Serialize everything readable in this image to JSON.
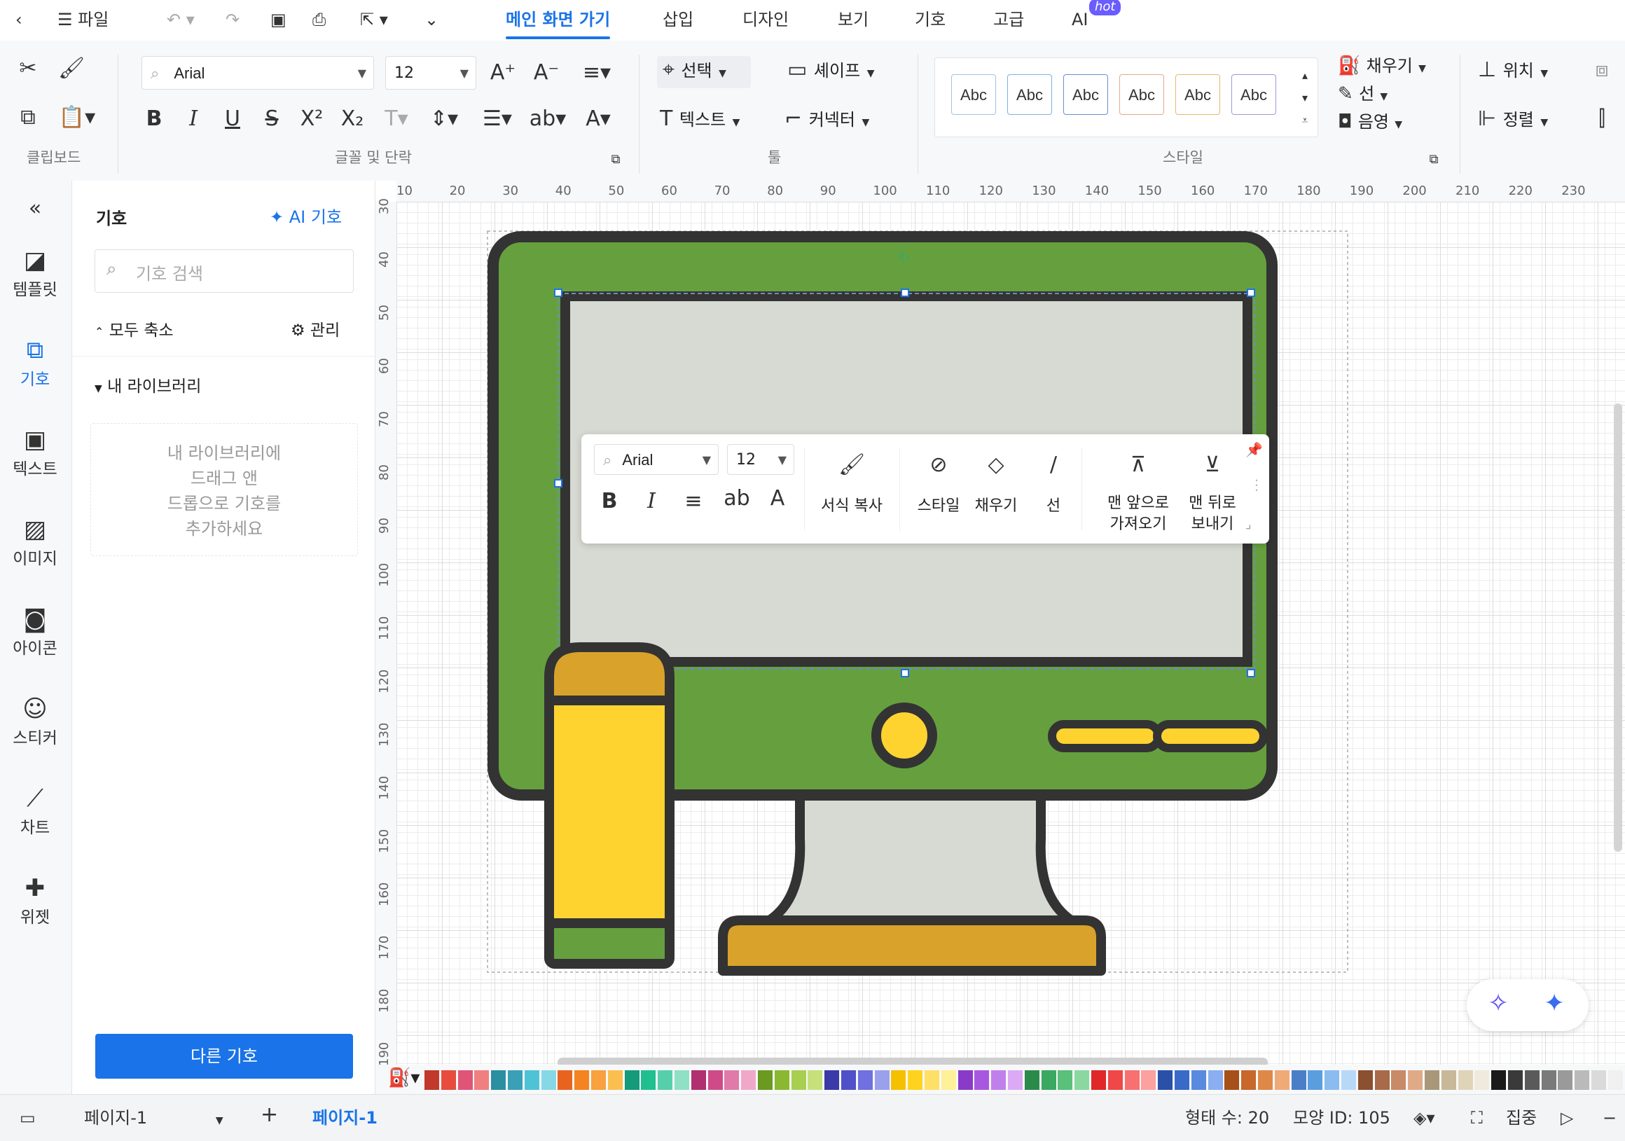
{
  "topbar": {
    "file_label": "파일",
    "tabs": [
      "메인 화면 가기",
      "삽입",
      "디자인",
      "보기",
      "기호",
      "고급",
      "AI"
    ],
    "hot_badge": "hot"
  },
  "ribbon": {
    "font_name": "Arial",
    "font_size": "12",
    "select_label": "선택",
    "shape_label": "셰이프",
    "text_label": "텍스트",
    "connector_label": "커넥터",
    "style_samples": [
      "Abc",
      "Abc",
      "Abc",
      "Abc",
      "Abc",
      "Abc"
    ],
    "style_sample_colors": [
      "#9dc3e6",
      "#7fb0e0",
      "#6a8fd0",
      "#e8a88a",
      "#e8b86a",
      "#9a9adf"
    ],
    "fill_label": "채우기",
    "line_label": "선",
    "shadow_label": "음영",
    "position_label": "위치",
    "align_label": "정렬",
    "groups": {
      "clipboard": "클립보드",
      "font": "글꼴 및 단락",
      "tools": "툴",
      "style": "스타일"
    },
    "text_buttons": {
      "bold": "B",
      "italic": "I",
      "underline": "U",
      "strike": "S",
      "superscript": "X²",
      "subscript": "X₂",
      "case": "ab",
      "font_color": "A"
    }
  },
  "rail": {
    "items": [
      {
        "label": "템플릿",
        "icon": "template-icon"
      },
      {
        "label": "기호",
        "icon": "symbol-icon"
      },
      {
        "label": "텍스트",
        "icon": "text-icon"
      },
      {
        "label": "이미지",
        "icon": "image-icon"
      },
      {
        "label": "아이콘",
        "icon": "icon-icon"
      },
      {
        "label": "스티커",
        "icon": "sticker-icon"
      },
      {
        "label": "차트",
        "icon": "chart-icon"
      },
      {
        "label": "위젯",
        "icon": "widget-icon"
      }
    ]
  },
  "panel": {
    "title": "기호",
    "ai_symbol": "AI 기호",
    "search_placeholder": "기호 검색",
    "collapse_all": "모두 축소",
    "manage": "관리",
    "my_library": "내 라이브러리",
    "drop_hint_lines": [
      "내 라이브러리에",
      "드래그 앤",
      "드롭으로 기호를",
      "추가하세요"
    ],
    "more_symbols": "다른 기호"
  },
  "ruler": {
    "h_ticks": [
      "10",
      "20",
      "30",
      "40",
      "50",
      "60",
      "70",
      "80",
      "90",
      "100",
      "110",
      "120",
      "130",
      "140",
      "150",
      "160",
      "170",
      "180",
      "190",
      "200",
      "210",
      "220",
      "230"
    ],
    "v_ticks": [
      "30",
      "40",
      "50",
      "60",
      "70",
      "80",
      "90",
      "100",
      "110",
      "120",
      "130",
      "140",
      "150",
      "160",
      "170",
      "180",
      "190"
    ]
  },
  "float_toolbar": {
    "font_name": "Arial",
    "font_size": "12",
    "bold": "B",
    "italic": "I",
    "case": "ab",
    "font_color": "A",
    "format_painter": "서식 복사",
    "style": "스타일",
    "fill": "채우기",
    "line": "선",
    "bring_front_lines": [
      "맨 앞으로",
      "가져오기"
    ],
    "send_back_lines": [
      "맨 뒤로",
      "보내기"
    ]
  },
  "illustration": {
    "frame_color": "#66a03e",
    "outline_color": "#333333",
    "screen_color": "#d7dad2",
    "accent_yellow": "#fed330",
    "accent_gold": "#d9a22a",
    "stand_color": "#d7dad2"
  },
  "palette_colors": [
    "#c0392b",
    "#e74c3c",
    "#e05577",
    "#f08080",
    "#2a8fa0",
    "#39a0b8",
    "#4fc3d6",
    "#86d8e6",
    "#e8641e",
    "#f5831f",
    "#f9a03f",
    "#fbbf4f",
    "#159a7a",
    "#1fbf8f",
    "#56d0aa",
    "#8fe0c4",
    "#b03070",
    "#d04a8a",
    "#e07aa8",
    "#f0a8c8",
    "#6a9a20",
    "#8ab830",
    "#a8cf50",
    "#c8e07a",
    "#3a3aa8",
    "#5050c8",
    "#7070e0",
    "#9aa0ec",
    "#f5c000",
    "#ffd21f",
    "#ffe066",
    "#fff09a",
    "#8a3ac8",
    "#a858e0",
    "#c080ec",
    "#dcaaf4",
    "#2a8a4a",
    "#3aa860",
    "#5ac07a",
    "#8ad8a0",
    "#e02828",
    "#f04848",
    "#f87070",
    "#fca0a0",
    "#2a50a8",
    "#3a6ac8",
    "#5a8ae0",
    "#8aaef0",
    "#a8501a",
    "#c8682a",
    "#e08848",
    "#f0aa78",
    "#4a7fc8",
    "#5a9ee0",
    "#8abcf0",
    "#b8d8f8",
    "#8a5030",
    "#a86a48",
    "#c88a68",
    "#e0aa88",
    "#a89878",
    "#c8b898",
    "#e0d4b8",
    "#f0eadc",
    "#1a1a1a",
    "#3a3a3a",
    "#5a5a5a",
    "#7a7a7a",
    "#9a9a9a",
    "#bababa",
    "#dadada",
    "#f0f0f0"
  ],
  "status": {
    "page_selector": "페이지-1",
    "page_tab": "페이지-1",
    "shape_count": "형태 수: 20",
    "shape_id": "모양 ID: 105",
    "focus": "집중"
  },
  "fab": {
    "colors": [
      "#5b4cf0",
      "#3a6cf0"
    ]
  }
}
